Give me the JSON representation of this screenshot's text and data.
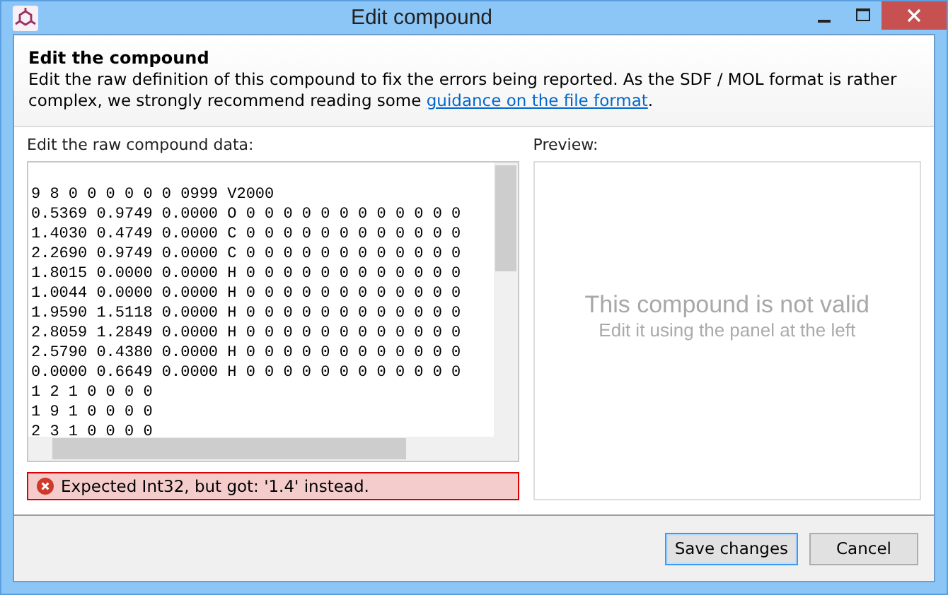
{
  "window": {
    "title": "Edit compound"
  },
  "header": {
    "title": "Edit the compound",
    "text": "Edit the raw definition of this compound to fix the errors being reported. As the SDF / MOL format is rather complex, we strongly recommend reading some ",
    "link": "guidance on the file format",
    "after": "."
  },
  "editor": {
    "label": "Edit the raw compound data:",
    "lines": [
      "9 8 0 0 0 0 0 0 0999 V2000",
      "0.5369 0.9749 0.0000 O 0 0 0 0 0 0 0 0 0 0 0 0",
      "1.4030 0.4749 0.0000 C 0 0 0 0 0 0 0 0 0 0 0 0",
      "2.2690 0.9749 0.0000 C 0 0 0 0 0 0 0 0 0 0 0 0",
      "1.8015 0.0000 0.0000 H 0 0 0 0 0 0 0 0 0 0 0 0",
      "1.0044 0.0000 0.0000 H 0 0 0 0 0 0 0 0 0 0 0 0",
      "1.9590 1.5118 0.0000 H 0 0 0 0 0 0 0 0 0 0 0 0",
      "2.8059 1.2849 0.0000 H 0 0 0 0 0 0 0 0 0 0 0 0",
      "2.5790 0.4380 0.0000 H 0 0 0 0 0 0 0 0 0 0 0 0",
      "0.0000 0.6649 0.0000 H 0 0 0 0 0 0 0 0 0 0 0 0",
      "1 2 1 0 0 0 0",
      "1 9 1 0 0 0 0",
      "2 3 1 0 0 0 0"
    ],
    "error": "Expected Int32, but got: '1.4' instead."
  },
  "preview": {
    "label": "Preview:",
    "title": "This compound is not valid",
    "subtitle": "Edit it using the panel at the left"
  },
  "buttons": [
    {
      "label": "Save changes",
      "selected": true
    },
    {
      "label": "Cancel",
      "selected": false
    }
  ]
}
